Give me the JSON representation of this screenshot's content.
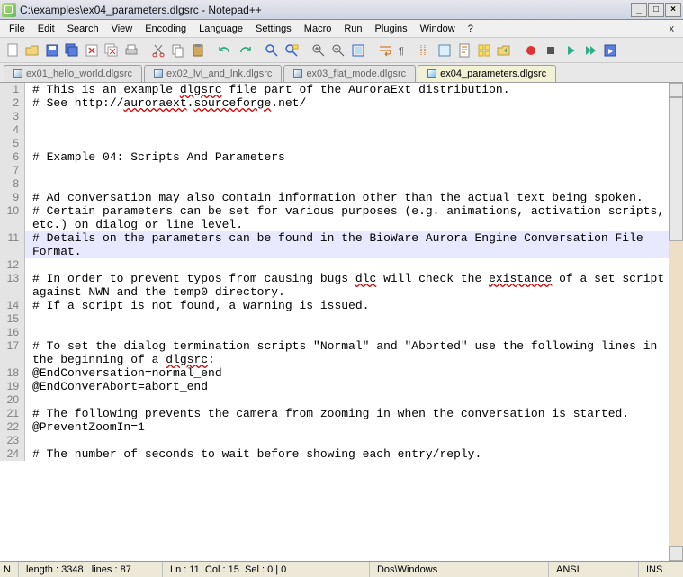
{
  "window": {
    "title": "C:\\examples\\ex04_parameters.dlgsrc - Notepad++"
  },
  "menu": {
    "file": "File",
    "edit": "Edit",
    "search": "Search",
    "view": "View",
    "encoding": "Encoding",
    "language": "Language",
    "settings": "Settings",
    "macro": "Macro",
    "run": "Run",
    "plugins": "Plugins",
    "window": "Window",
    "help": "?"
  },
  "tabs": [
    {
      "label": "ex01_hello_world.dlgsrc",
      "active": false
    },
    {
      "label": "ex02_lvl_and_lnk.dlgsrc",
      "active": false
    },
    {
      "label": "ex03_flat_mode.dlgsrc",
      "active": false
    },
    {
      "label": "ex04_parameters.dlgsrc",
      "active": true
    }
  ],
  "lines": [
    {
      "n": 1,
      "text": "# This is an example dlgsrc file part of the AuroraExt distribution."
    },
    {
      "n": 2,
      "text": "# See http://auroraext.sourceforge.net/"
    },
    {
      "n": 3,
      "text": ""
    },
    {
      "n": 4,
      "text": ""
    },
    {
      "n": 5,
      "text": ""
    },
    {
      "n": 6,
      "text": "# Example 04: Scripts And Parameters"
    },
    {
      "n": 7,
      "text": ""
    },
    {
      "n": 8,
      "text": ""
    },
    {
      "n": 9,
      "text": "# Ad conversation may also contain information other than the actual text being spoken.",
      "wrap": true
    },
    {
      "n": 10,
      "text": "# Certain parameters can be set for various purposes (e.g. animations, activation scripts, etc.) on dialog or line level.",
      "wrap": true
    },
    {
      "n": 11,
      "text": "# Details on the parameters can be found in the BioWare Aurora Engine Conversation File Format.",
      "wrap": true,
      "active": true
    },
    {
      "n": 12,
      "text": ""
    },
    {
      "n": 13,
      "text": "# In order to prevent typos from causing bugs dlc will check the existance of a set script against NWN and the temp0 directory.",
      "wrap": true
    },
    {
      "n": 14,
      "text": "# If a script is not found, a warning is issued."
    },
    {
      "n": 15,
      "text": ""
    },
    {
      "n": 16,
      "text": ""
    },
    {
      "n": 17,
      "text": "# To set the dialog termination scripts \"Normal\" and \"Aborted\" use the following lines in the beginning of a dlgsrc:",
      "wrap": true
    },
    {
      "n": 18,
      "text": "@EndConversation=normal_end"
    },
    {
      "n": 19,
      "text": "@EndConverAbort=abort_end"
    },
    {
      "n": 20,
      "text": ""
    },
    {
      "n": 21,
      "text": "# The following prevents the camera from zooming in when the conversation is started."
    },
    {
      "n": 22,
      "text": "@PreventZoomIn=1"
    },
    {
      "n": 23,
      "text": ""
    },
    {
      "n": 24,
      "text": "# The number of seconds to wait before showing each entry/reply."
    }
  ],
  "squiggles": [
    "dlgsrc",
    "auroraext",
    "sourceforge",
    "dlc",
    "existance"
  ],
  "status": {
    "length_label": "length :",
    "length_val": "3348",
    "lines_label": "lines :",
    "lines_val": "87",
    "ln_label": "Ln :",
    "ln_val": "11",
    "col_label": "Col :",
    "col_val": "15",
    "sel_label": "Sel :",
    "sel_val": "0 | 0",
    "eol": "Dos\\Windows",
    "enc": "ANSI",
    "mode": "INS",
    "nb": "N"
  }
}
